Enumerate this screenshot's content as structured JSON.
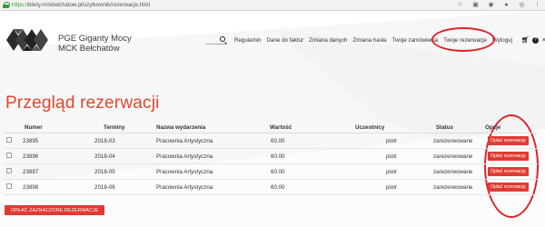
{
  "browser": {
    "url_secure": "https://",
    "url_rest": "bilety.mckbelchatow.pl/uzytkownik/rezerwacje.html"
  },
  "brand": {
    "line1": "PGE Giganty Mocy",
    "line2": "MCK Bełchatów"
  },
  "nav": {
    "items": [
      "Regulamin",
      "Dane do faktur",
      "Zmiana danych",
      "Zmiana hasła",
      "Twoje zamówienia",
      "Twoje rezerwacje",
      "Wyloguj"
    ],
    "help": "?"
  },
  "page": {
    "title": "Przegląd rezerwacji"
  },
  "table": {
    "headers": [
      "Numer",
      "Terminy",
      "Nazwa wydarzenia",
      "Wartość",
      "Uczestnicy",
      "Status",
      "Opcje"
    ],
    "rows": [
      {
        "numer": "23895",
        "termin": "2018-03",
        "nazwa": "Pracownia Artystyczna",
        "wartosc": "60.00",
        "uczestnicy": "piotr",
        "status": "zarezerwowane",
        "opcja": "Opłać rezerwację"
      },
      {
        "numer": "23896",
        "termin": "2018-04",
        "nazwa": "Pracownia Artystyczna",
        "wartosc": "60.00",
        "uczestnicy": "piotr",
        "status": "zarezerwowane",
        "opcja": "Opłać rezerwację"
      },
      {
        "numer": "23897",
        "termin": "2018-05",
        "nazwa": "Pracownia Artystyczna",
        "wartosc": "60.00",
        "uczestnicy": "piotr",
        "status": "zarezerwowane",
        "opcja": "Opłać rezerwację"
      },
      {
        "numer": "23898",
        "termin": "2018-06",
        "nazwa": "Pracownia Artystyczna",
        "wartosc": "60.00",
        "uczestnicy": "piotr",
        "status": "zarezerwowane",
        "opcja": "Opłać rezerwację"
      }
    ]
  },
  "footer": {
    "pay_selected": "OPŁAĆ ZAZNACZONE REZERWACJE"
  },
  "colors": {
    "accent": "#e2462a",
    "button": "#e03a33",
    "annotation": "#e0202a"
  }
}
